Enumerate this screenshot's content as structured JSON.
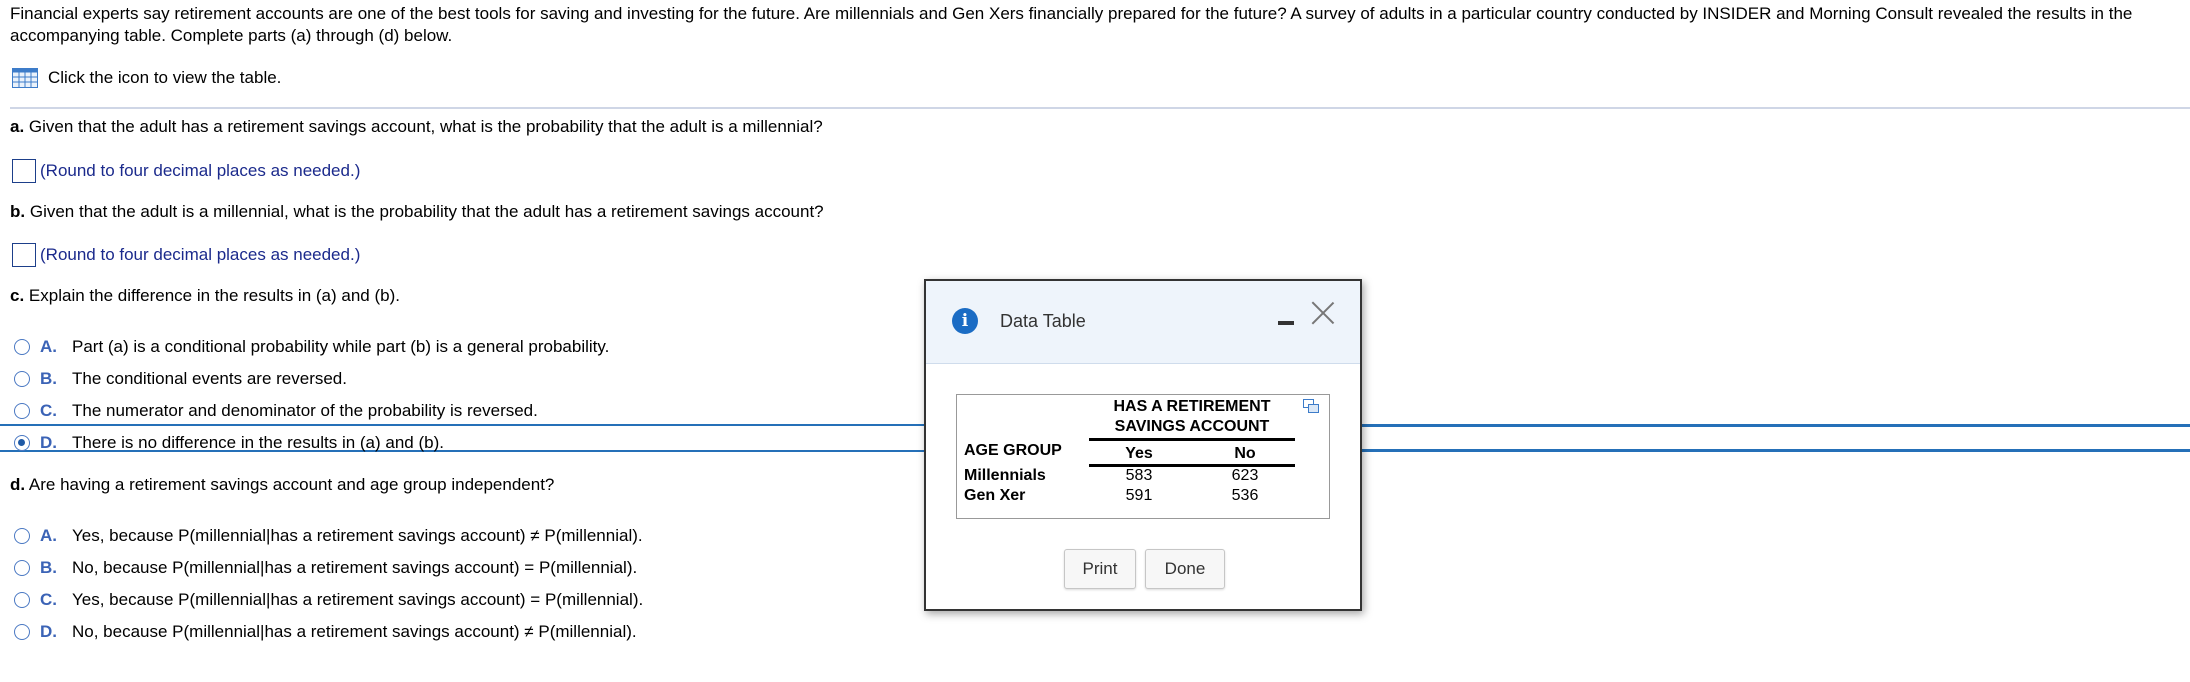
{
  "intro": "Financial experts say retirement accounts are one of the best tools for saving and investing for the future. Are millennials and Gen Xers financially prepared for the future? A survey of adults in a particular country conducted by INSIDER and Morning Consult revealed the results in the accompanying table. Complete parts (a) through (d) below.",
  "click_icon_text": "Click the icon to view the table.",
  "part_a": {
    "letter": "a.",
    "question": "Given that the adult has a retirement savings account, what is the probability that the adult is a millennial?",
    "hint": "(Round to four decimal places as needed.)"
  },
  "part_b": {
    "letter": "b.",
    "question": "Given that the adult is a millennial, what is the probability that the adult has a retirement savings account?",
    "hint": "(Round to four decimal places as needed.)"
  },
  "part_c": {
    "letter": "c.",
    "question": "Explain the difference in the results in (a) and (b).",
    "options": [
      {
        "letter": "A.",
        "text": "Part (a) is a conditional probability while part (b) is a general probability.",
        "selected": false
      },
      {
        "letter": "B.",
        "text": "The conditional events are reversed.",
        "selected": false
      },
      {
        "letter": "C.",
        "text": "The numerator and denominator of the probability is reversed.",
        "selected": false
      },
      {
        "letter": "D.",
        "text": "There is no difference in the results in (a) and (b).",
        "selected": true
      }
    ]
  },
  "part_d": {
    "letter": "d.",
    "question": "Are having a retirement savings account and age group independent?",
    "options": [
      {
        "letter": "A.",
        "text": "Yes, because P(millennial|has a retirement savings account) ≠ P(millennial).",
        "selected": false
      },
      {
        "letter": "B.",
        "text": "No, because P(millennial|has a retirement savings account) = P(millennial).",
        "selected": false
      },
      {
        "letter": "C.",
        "text": "Yes, because P(millennial|has a retirement savings account) = P(millennial).",
        "selected": false
      },
      {
        "letter": "D.",
        "text": "No, because P(millennial|has a retirement savings account) ≠ P(millennial).",
        "selected": false
      }
    ]
  },
  "dialog": {
    "title": "Data Table",
    "table": {
      "group_header_line1": "HAS A RETIREMENT",
      "group_header_line2": "SAVINGS ACCOUNT",
      "row_header": "AGE GROUP",
      "columns": [
        "Yes",
        "No"
      ],
      "rows": [
        {
          "label": "Millennials",
          "values": [
            "583",
            "623"
          ]
        },
        {
          "label": "Gen Xer",
          "values": [
            "591",
            "536"
          ]
        }
      ]
    },
    "print_label": "Print",
    "done_label": "Done"
  },
  "icons": {
    "table": "table-grid-icon",
    "info": "info-icon",
    "copy": "copy-icon"
  },
  "colors": {
    "accent": "#2570b8",
    "option_letter": "#3b63b6",
    "hint": "#1b2a8c"
  }
}
